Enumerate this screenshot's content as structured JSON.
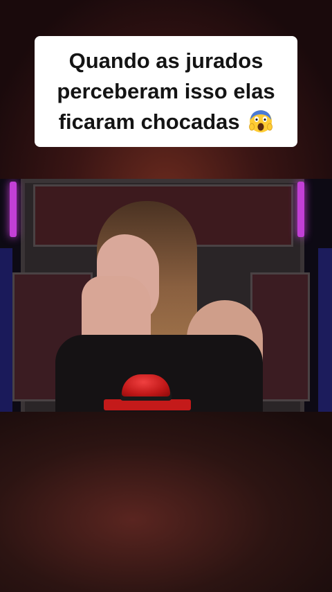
{
  "caption": {
    "line1": "Quando as jurados",
    "line2": "perceberam isso elas",
    "line3": "ficaram chocadas",
    "emoji": "face-screaming-in-fear-icon"
  },
  "video": {
    "scene": "judge-chair-with-red-button"
  },
  "colors": {
    "caption_bg": "#ffffff",
    "caption_text": "#141414",
    "neon": "#c23fd6",
    "buzzer": "#c41a1a"
  }
}
